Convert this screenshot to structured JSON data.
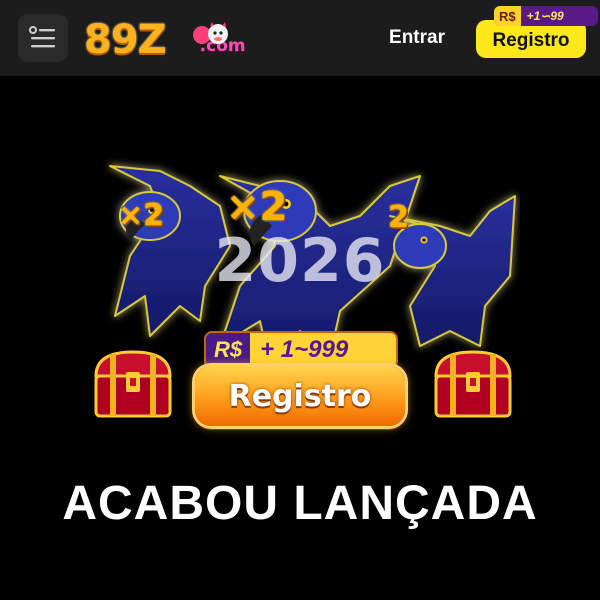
{
  "header": {
    "logo": {
      "brand": "89Z",
      "suffix": ".com"
    },
    "login_label": "Entrar",
    "register_label": "Registro",
    "register_badge": {
      "currency": "R$",
      "range": "+1∽99"
    }
  },
  "banner": {
    "multipliers": [
      "×2",
      "×2",
      "2"
    ],
    "year": "2026",
    "promo": {
      "currency": "R$",
      "range": "+ 1~999"
    },
    "cta_label": "Registro",
    "headline": "ACABOU LANÇADA"
  },
  "icons": [
    "menu-icon",
    "mascot-icon",
    "macaw-icon",
    "treasure-chest-icon"
  ],
  "colors": {
    "accent_yellow": "#ffe81a",
    "logo_orange": "#ffb21c",
    "badge_purple": "#5a1a86",
    "cta_orange": "#ff9d1a"
  }
}
